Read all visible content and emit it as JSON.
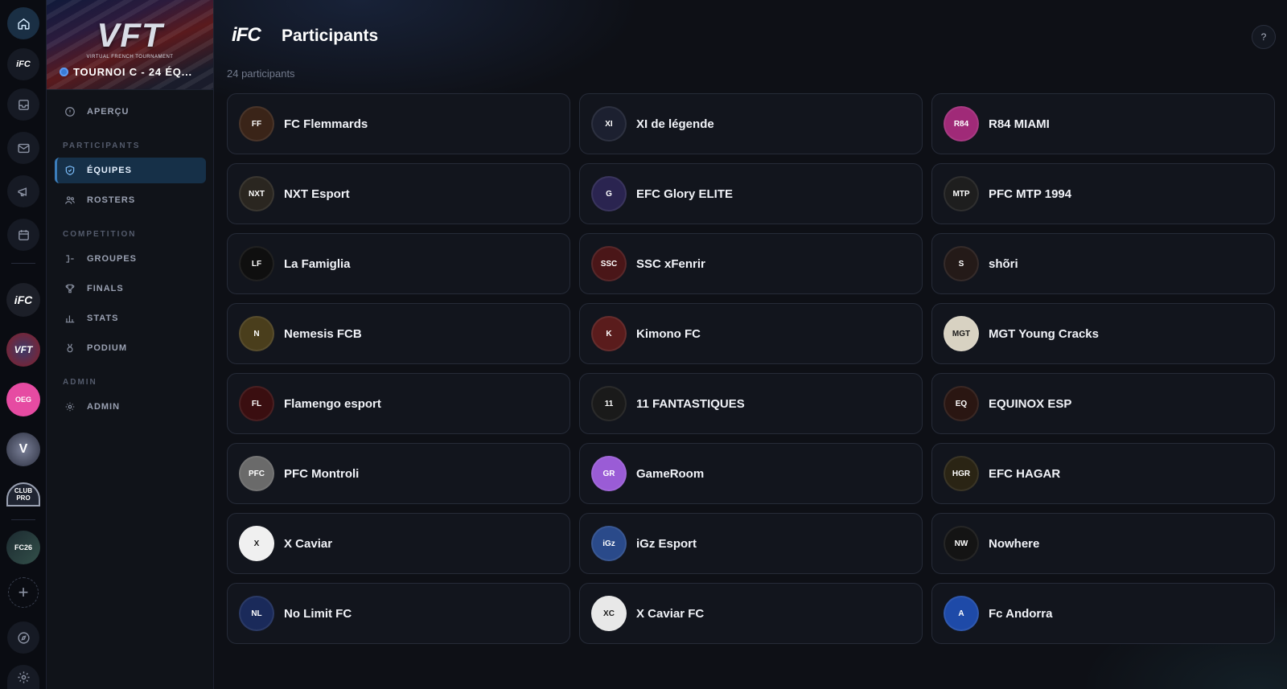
{
  "rail": {
    "avatars": [
      {
        "text": "iFC",
        "bg": "#1c1f28"
      },
      {
        "text": "VFT",
        "bg": "#2a2440"
      },
      {
        "text": "OEG",
        "bg": "#e64ba2"
      },
      {
        "text": "V",
        "bg": "#4b5066"
      },
      {
        "text": "CLUB PRO",
        "bg": "#1f2431"
      },
      {
        "text": "FC26",
        "bg": "#1c2a30"
      }
    ]
  },
  "sidebar": {
    "banner_logo": "VFT",
    "banner_logo_sub": "VIRTUAL FRENCH TOURNAMENT",
    "tournament_title": "TOURNOI C - 24 ÉQ...",
    "overview_label": "APERÇU",
    "sections": {
      "participants": "PARTICIPANTS",
      "competition": "COMPETITION",
      "admin": "ADMIN"
    },
    "items": {
      "equipes": "ÉQUIPES",
      "rosters": "ROSTERS",
      "groupes": "GROUPES",
      "finals": "FINALS",
      "stats": "STATS",
      "podium": "PODIUM",
      "admin": "ADMIN"
    }
  },
  "header": {
    "logo_text": "iFC",
    "title": "Participants",
    "help_label": "?"
  },
  "count_text": "24 participants",
  "teams": [
    {
      "name": "FC Flemmards",
      "color": "#3a2418",
      "initials": "FF"
    },
    {
      "name": "XI de légende",
      "color": "#1c2030",
      "initials": "XI"
    },
    {
      "name": "R84 MIAMI",
      "color": "#a02a78",
      "initials": "R84"
    },
    {
      "name": "NXT Esport",
      "color": "#2a2620",
      "initials": "NXT"
    },
    {
      "name": "EFC Glory ELITE",
      "color": "#2a2450",
      "initials": "G"
    },
    {
      "name": "PFC MTP 1994",
      "color": "#1e1e1e",
      "initials": "MTP"
    },
    {
      "name": "La Famiglia",
      "color": "#0f0f0f",
      "initials": "LF"
    },
    {
      "name": "SSC xFenrir",
      "color": "#4a1618",
      "initials": "SSC"
    },
    {
      "name": "shõri",
      "color": "#241a18",
      "initials": "S"
    },
    {
      "name": "Nemesis FCB",
      "color": "#4a3e1c",
      "initials": "N"
    },
    {
      "name": "Kimono FC",
      "color": "#5a1c1c",
      "initials": "K"
    },
    {
      "name": "MGT Young Cracks",
      "color": "#d8d2c2",
      "initials": "MGT"
    },
    {
      "name": "Flamengo esport",
      "color": "#3a0e10",
      "initials": "FL"
    },
    {
      "name": "11 FANTASTIQUES",
      "color": "#1a1a1a",
      "initials": "11"
    },
    {
      "name": "EQUINOX ESP",
      "color": "#2a1612",
      "initials": "EQ"
    },
    {
      "name": "PFC Montroli",
      "color": "#6a6a6a",
      "initials": "PFC"
    },
    {
      "name": "GameRoom",
      "color": "#9a5cd6",
      "initials": "GR"
    },
    {
      "name": "EFC HAGAR",
      "color": "#2a2414",
      "initials": "HGR"
    },
    {
      "name": "X Caviar",
      "color": "#f0f0f0",
      "initials": "X"
    },
    {
      "name": "iGz Esport",
      "color": "#2a4a8a",
      "initials": "iGz"
    },
    {
      "name": "Nowhere",
      "color": "#141414",
      "initials": "NW"
    },
    {
      "name": "No Limit FC",
      "color": "#1a2a5a",
      "initials": "NL"
    },
    {
      "name": "X Caviar FC",
      "color": "#e8e8e8",
      "initials": "XC"
    },
    {
      "name": "Fc Andorra",
      "color": "#1e4aa8",
      "initials": "A"
    }
  ]
}
